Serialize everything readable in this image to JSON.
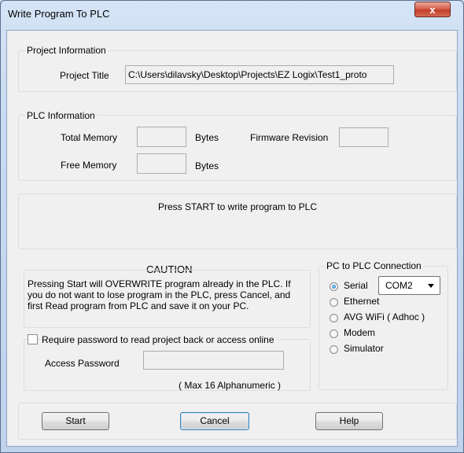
{
  "window": {
    "title": "Write Program To PLC",
    "close_glyph": "x"
  },
  "project_info": {
    "legend": "Project Information",
    "title_label": "Project Title",
    "title_value": "C:\\Users\\dilavsky\\Desktop\\Projects\\EZ Logix\\Test1_proto"
  },
  "plc_info": {
    "legend": "PLC Information",
    "total_memory_label": "Total Memory",
    "total_memory_unit": "Bytes",
    "free_memory_label": "Free Memory",
    "free_memory_unit": "Bytes",
    "firmware_label": "Firmware Revision"
  },
  "status": {
    "message": "Press START to write program to PLC"
  },
  "caution": {
    "title": "CAUTION",
    "line1": "Pressing Start will OVERWRITE program already in the PLC. If",
    "line2": "you do not want to lose program in the PLC, press Cancel, and",
    "line3": "first Read program from PLC and save it on your PC."
  },
  "password": {
    "checkbox_label": "Require password to read project back or access online",
    "field_label": "Access Password",
    "hint": "( Max 16 Alphanumeric )",
    "checked": false
  },
  "connection": {
    "legend": "PC to PLC Connection",
    "serial": "Serial",
    "ethernet": "Ethernet",
    "wifi": "AVG WiFi ( Adhoc )",
    "modem": "Modem",
    "simulator": "Simulator",
    "selected": "Serial",
    "com_port": "COM2"
  },
  "buttons": {
    "start": "Start",
    "cancel": "Cancel",
    "help": "Help"
  }
}
